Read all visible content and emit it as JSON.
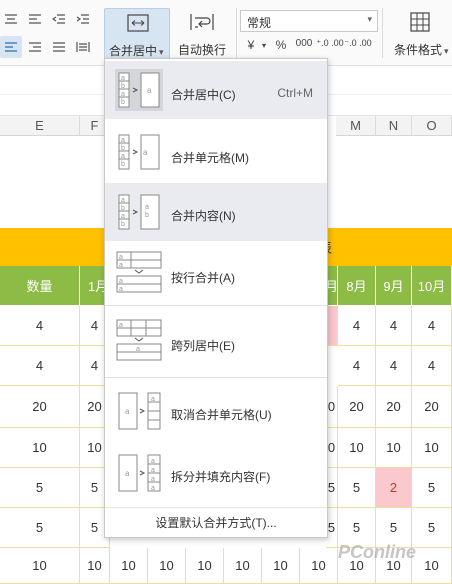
{
  "ribbon": {
    "merge_label": "合并居中",
    "merge_arrow": "▾",
    "wrap_label": "自动换行",
    "number_format": "常规",
    "number_format_arrow": "▾",
    "num_icons": [
      "¥",
      "▾",
      "%",
      "000",
      "⁺.0 .00",
      "⁻.0 .00"
    ],
    "cond_label": "条件格式",
    "cond_arrow": "▾"
  },
  "columns": [
    "E",
    "F",
    "M",
    "N",
    "O"
  ],
  "table": {
    "header_cells": [
      "数量",
      "1月",
      "月",
      "8月",
      "9月",
      "10月"
    ],
    "title_fragment": "表",
    "rows": [
      {
        "left": [
          "4",
          "4"
        ],
        "right": [
          "4",
          "4",
          "4"
        ]
      },
      {
        "left": [
          "4",
          "4"
        ],
        "right": [
          "4",
          "4",
          "4"
        ]
      },
      {
        "left": [
          "20",
          "20"
        ],
        "mid": "0",
        "right": [
          "20",
          "20",
          "20"
        ]
      },
      {
        "left": [
          "10",
          "10"
        ],
        "mid": "0",
        "right": [
          "10",
          "10",
          "10"
        ]
      },
      {
        "left": [
          "5",
          "5"
        ],
        "mid": "5",
        "right": [
          "5",
          "2",
          "5"
        ]
      },
      {
        "left": [
          "5",
          "5"
        ],
        "mid": "5",
        "right": [
          "5",
          "5",
          "5"
        ]
      },
      {
        "left": [
          "10",
          "10"
        ],
        "bottom": [
          "10",
          "10",
          "10",
          "10",
          "10",
          "10"
        ],
        "right": [
          "10",
          "10",
          "10"
        ]
      }
    ]
  },
  "menu": {
    "items": [
      {
        "label": "合并居中(C)",
        "shortcut": "Ctrl+M"
      },
      {
        "label": "合并单元格(M)",
        "shortcut": ""
      },
      {
        "label": "合并内容(N)",
        "shortcut": ""
      },
      {
        "label": "按行合并(A)",
        "shortcut": ""
      },
      {
        "label": "跨列居中(E)",
        "shortcut": ""
      },
      {
        "label": "取消合并单元格(U)",
        "shortcut": ""
      },
      {
        "label": "拆分并填充内容(F)",
        "shortcut": ""
      }
    ],
    "footer": "设置默认合并方式(T)..."
  },
  "watermark": "PConline",
  "colors": {
    "title_row": "#ffc000",
    "header_row": "#8cbc46",
    "highlight_cell": "#fbc8cd",
    "menu_highlight": "#e9ebf0"
  }
}
